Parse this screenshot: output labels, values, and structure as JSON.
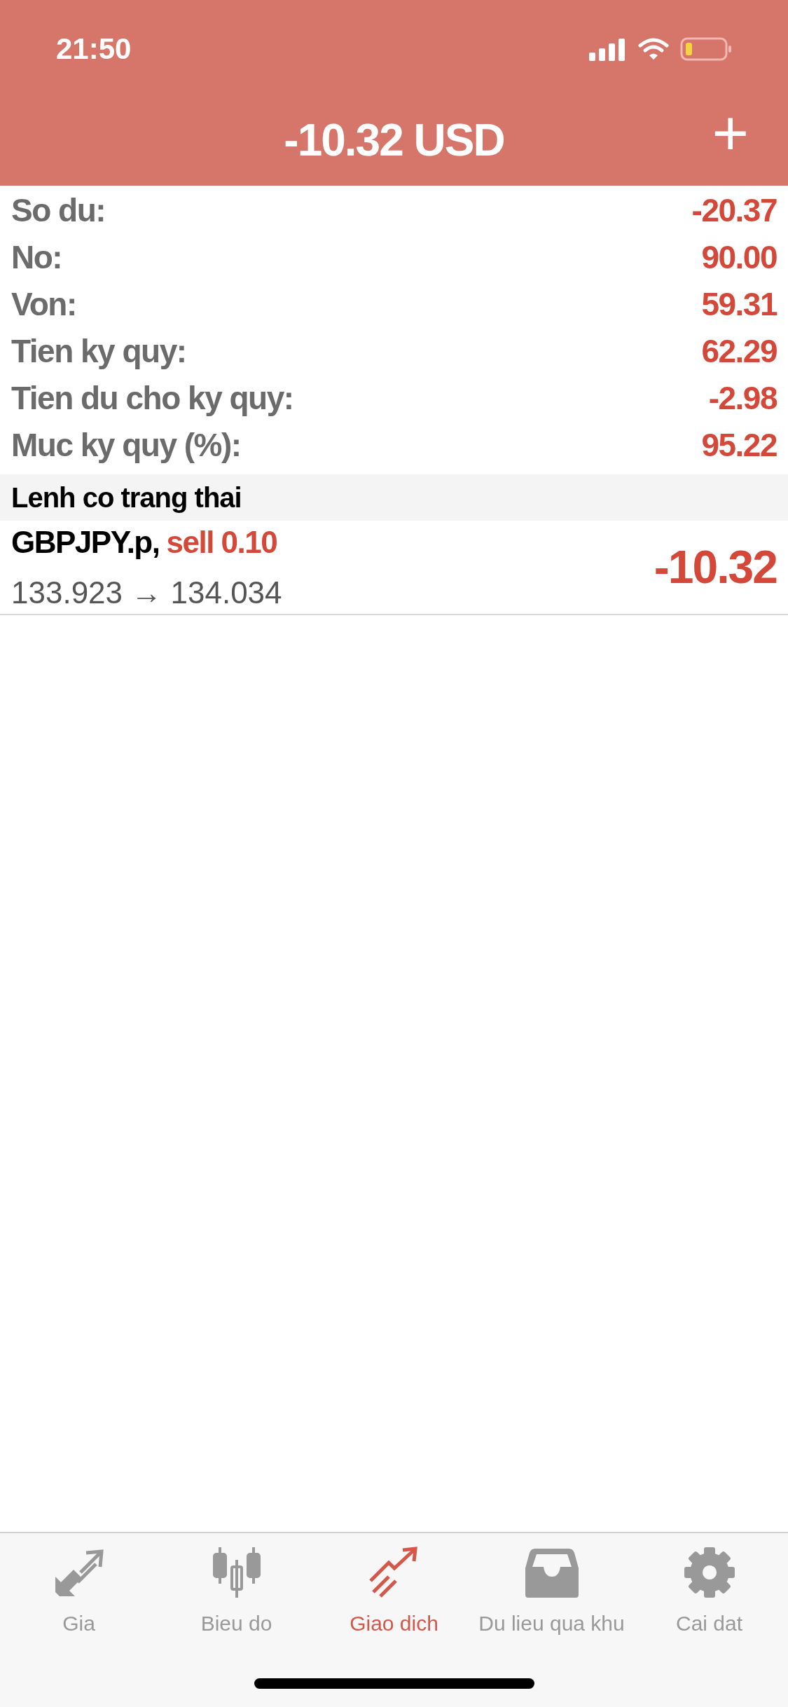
{
  "status_bar": {
    "time": "21:50"
  },
  "header": {
    "title": "-10.32 USD",
    "add_button": "+"
  },
  "summary": [
    {
      "label": "So du:",
      "value": "-20.37"
    },
    {
      "label": "No:",
      "value": "90.00"
    },
    {
      "label": "Von:",
      "value": "59.31"
    },
    {
      "label": "Tien ky quy:",
      "value": "62.29"
    },
    {
      "label": "Tien du cho ky quy:",
      "value": "-2.98"
    },
    {
      "label": "Muc ky quy (%):",
      "value": "95.22"
    }
  ],
  "section": {
    "title": "Lenh co trang thai"
  },
  "positions": [
    {
      "symbol": "GBPJPY.p,",
      "side": "sell 0.10",
      "prices": "133.923 → 134.034",
      "profit": "-10.32"
    }
  ],
  "tabs": [
    {
      "kind": "quotes",
      "label": "Gia",
      "selected": false
    },
    {
      "kind": "chart",
      "label": "Bieu do",
      "selected": false
    },
    {
      "kind": "trade",
      "label": "Giao dich",
      "selected": true
    },
    {
      "kind": "history",
      "label": "Du lieu qua khu",
      "selected": false
    },
    {
      "kind": "settings",
      "label": "Cai dat",
      "selected": false
    }
  ]
}
